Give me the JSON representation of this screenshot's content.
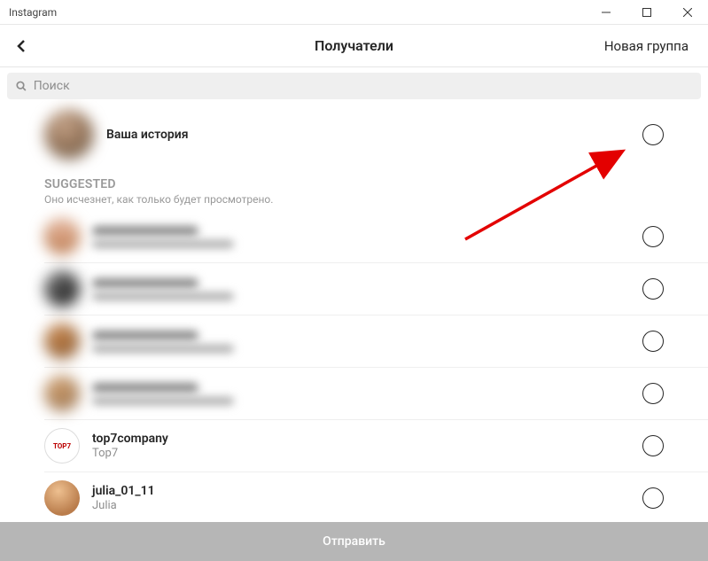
{
  "window": {
    "title": "Instagram"
  },
  "header": {
    "title": "Получатели",
    "new_group": "Новая группа"
  },
  "search": {
    "placeholder": "Поиск"
  },
  "story": {
    "label": "Ваша история"
  },
  "section": {
    "title": "SUGGESTED",
    "subtitle": "Оно исчезнет, как только будет просмотрено."
  },
  "suggested": [
    {
      "username": "",
      "display": "",
      "blurred": true,
      "avatar": "av1"
    },
    {
      "username": "",
      "display": "",
      "blurred": true,
      "avatar": "av2"
    },
    {
      "username": "",
      "display": "",
      "blurred": true,
      "avatar": "av3"
    },
    {
      "username": "",
      "display": "",
      "blurred": true,
      "avatar": "av4"
    },
    {
      "username": "top7company",
      "display": "Top7",
      "blurred": false,
      "avatar": "av5",
      "avatar_text": "TOP7"
    },
    {
      "username": "julia_01_11",
      "display": "Julia",
      "blurred": false,
      "avatar": "av6"
    }
  ],
  "send": {
    "label": "Отправить"
  }
}
